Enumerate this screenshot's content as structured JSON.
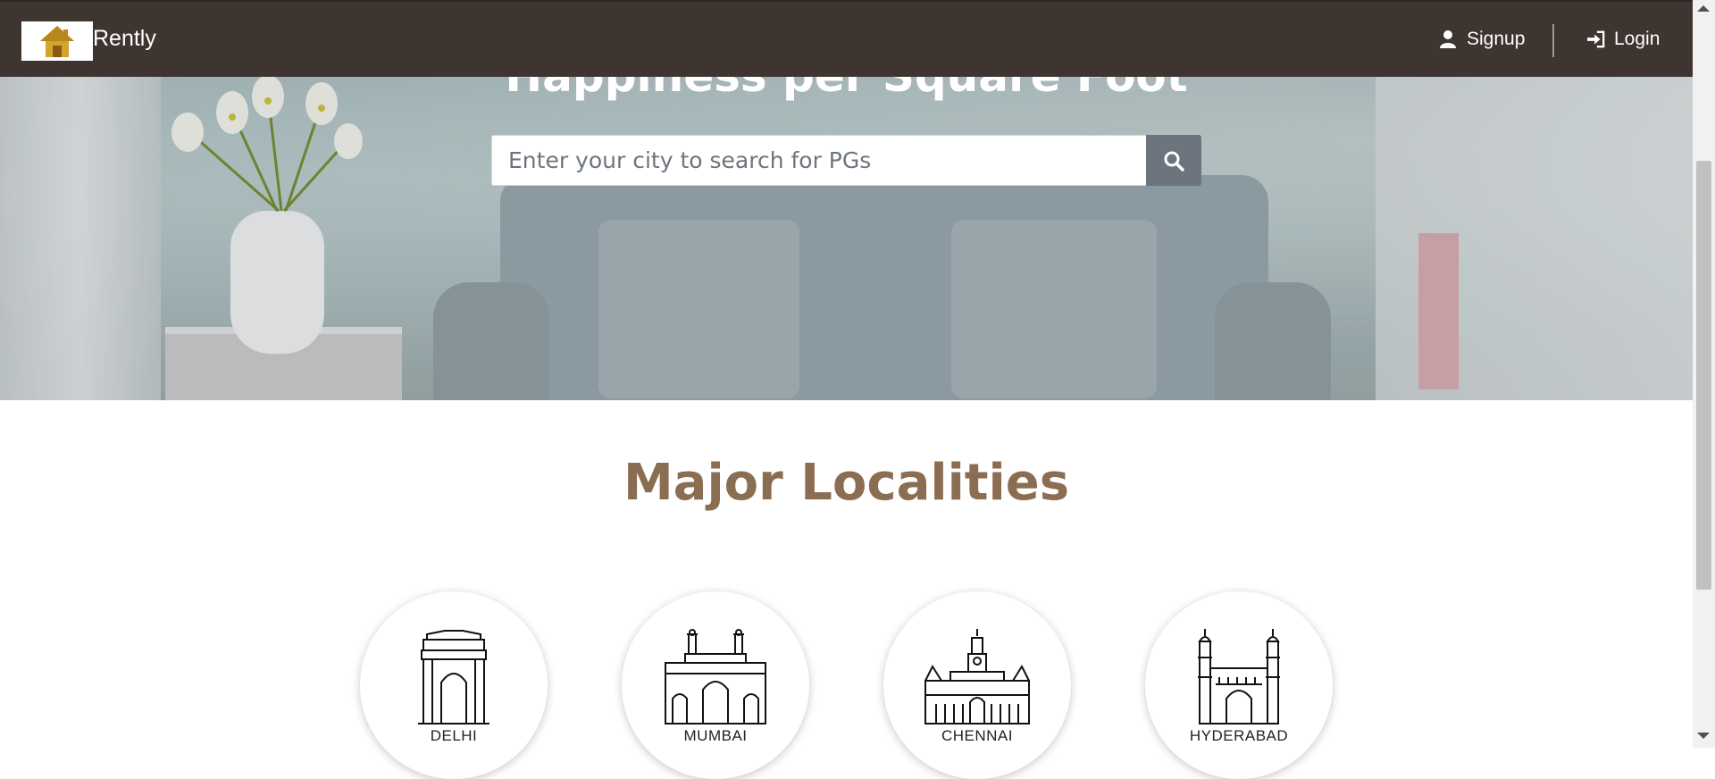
{
  "navbar": {
    "brand": "Rently",
    "logo_icon": "house-icon",
    "signup_label": "Signup",
    "signup_icon": "user-icon",
    "login_label": "Login",
    "login_icon": "sign-in-icon",
    "background_color": "#3e3430"
  },
  "hero": {
    "title": "Happiness per Square Foot",
    "search_placeholder": "Enter your city to search for PGs",
    "search_value": "",
    "search_icon": "search-icon"
  },
  "localities": {
    "title": "Major Localities",
    "title_color": "#8b6d52",
    "cities": [
      {
        "name": "DELHI",
        "icon": "india-gate-icon"
      },
      {
        "name": "MUMBAI",
        "icon": "gateway-of-india-icon"
      },
      {
        "name": "CHENNAI",
        "icon": "chennai-central-icon"
      },
      {
        "name": "HYDERABAD",
        "icon": "charminar-icon"
      }
    ]
  }
}
